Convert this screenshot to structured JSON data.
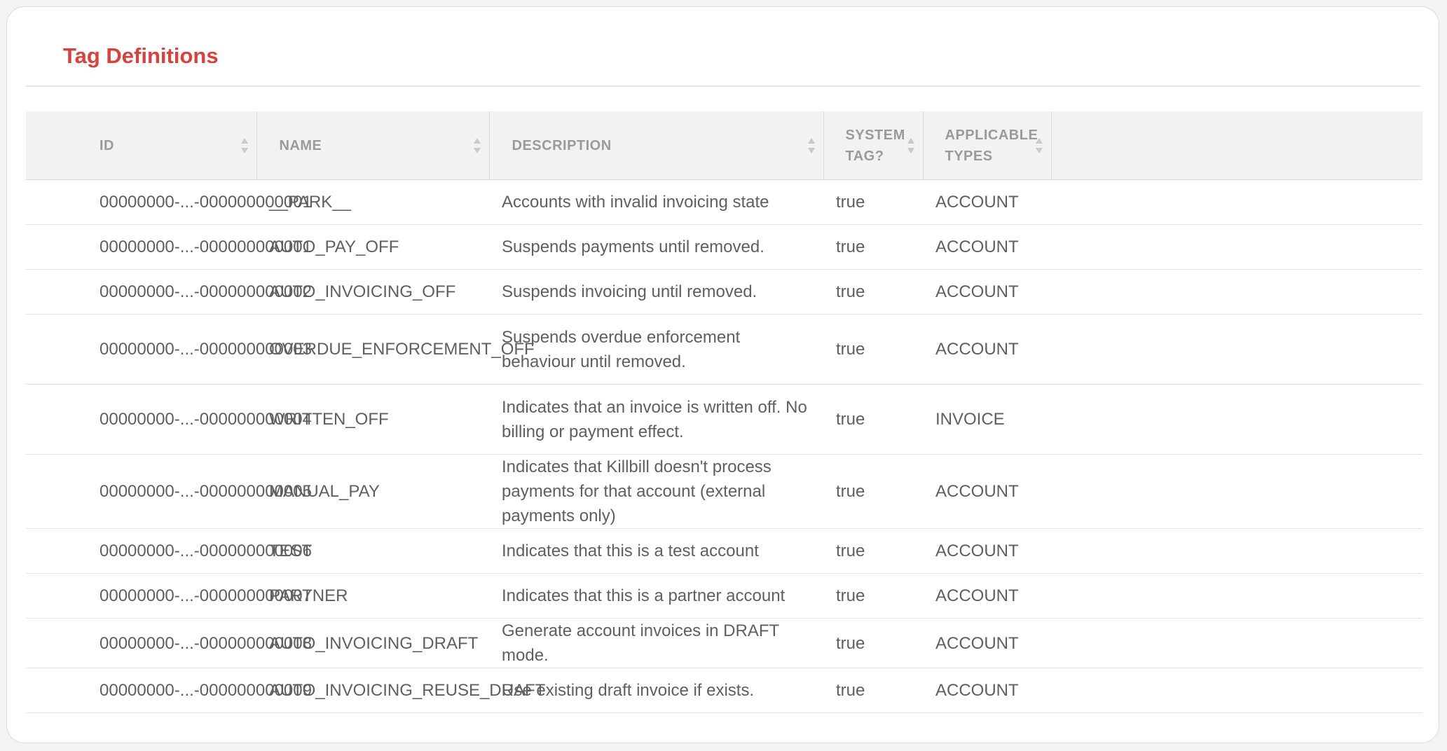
{
  "page": {
    "title": "Tag Definitions"
  },
  "table": {
    "columns": [
      {
        "key": "id",
        "label": "ID",
        "sortable": true
      },
      {
        "key": "name",
        "label": "NAME",
        "sortable": true
      },
      {
        "key": "description",
        "label": "DESCRIPTION",
        "sortable": true
      },
      {
        "key": "system_tag",
        "label": "SYSTEM TAG?",
        "sortable": true
      },
      {
        "key": "applicable_types",
        "label": "APPLICABLE TYPES",
        "sortable": true
      },
      {
        "key": "extra",
        "label": "",
        "sortable": false
      }
    ],
    "rows": [
      {
        "id": "00000000-...-000000000001",
        "name": "__PARK__",
        "description": "Accounts with invalid invoicing state",
        "system_tag": "true",
        "applicable_types": "ACCOUNT"
      },
      {
        "id": "00000000-...-000000000001",
        "name": "AUTO_PAY_OFF",
        "description": "Suspends payments until removed.",
        "system_tag": "true",
        "applicable_types": "ACCOUNT"
      },
      {
        "id": "00000000-...-000000000002",
        "name": "AUTO_INVOICING_OFF",
        "description": "Suspends invoicing until removed.",
        "system_tag": "true",
        "applicable_types": "ACCOUNT"
      },
      {
        "id": "00000000-...-000000000003",
        "name": "OVERDUE_ENFORCEMENT_OFF",
        "description": "Suspends overdue enforcement behaviour until removed.",
        "system_tag": "true",
        "applicable_types": "ACCOUNT"
      },
      {
        "id": "00000000-...-000000000004",
        "name": "WRITTEN_OFF",
        "description": "Indicates that an invoice is written off. No billing or payment effect.",
        "system_tag": "true",
        "applicable_types": "INVOICE"
      },
      {
        "id": "00000000-...-000000000005",
        "name": "MANUAL_PAY",
        "description": "Indicates that Killbill doesn't process payments for that account (external payments only)",
        "system_tag": "true",
        "applicable_types": "ACCOUNT"
      },
      {
        "id": "00000000-...-000000000006",
        "name": "TEST",
        "description": "Indicates that this is a test account",
        "system_tag": "true",
        "applicable_types": "ACCOUNT"
      },
      {
        "id": "00000000-...-000000000007",
        "name": "PARTNER",
        "description": "Indicates that this is a partner account",
        "system_tag": "true",
        "applicable_types": "ACCOUNT"
      },
      {
        "id": "00000000-...-000000000008",
        "name": "AUTO_INVOICING_DRAFT",
        "description": "Generate account invoices in DRAFT mode.",
        "system_tag": "true",
        "applicable_types": "ACCOUNT"
      },
      {
        "id": "00000000-...-000000000009",
        "name": "AUTO_INVOICING_REUSE_DRAFT",
        "description": "Use existing draft invoice if exists.",
        "system_tag": "true",
        "applicable_types": "ACCOUNT"
      }
    ]
  },
  "icons": {
    "sort": "sort-both-arrows-icon"
  },
  "colors": {
    "title": "#d9413a",
    "header_bg": "#f2f2f2",
    "header_text": "#9a9a9a",
    "cell_text": "#5f5f5f"
  }
}
